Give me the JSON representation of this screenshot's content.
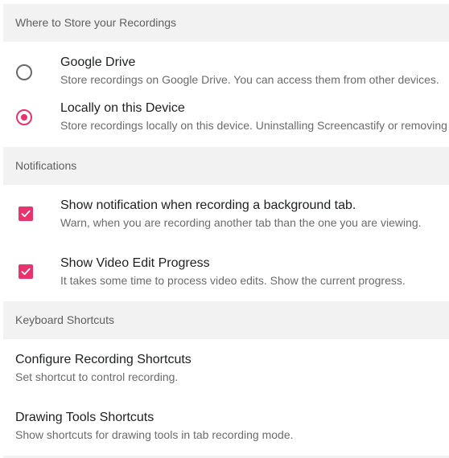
{
  "storage": {
    "header": "Where to Store your Recordings",
    "options": [
      {
        "title": "Google Drive",
        "description": "Store recordings on Google Drive. You can access them from other devices.",
        "selected": false
      },
      {
        "title": "Locally on this Device",
        "description": "Store recordings locally on this device. Uninstalling Screencastify or removing",
        "selected": true
      }
    ]
  },
  "notifications": {
    "header": "Notifications",
    "options": [
      {
        "title": "Show notification when recording a background tab.",
        "description": "Warn, when you are recording another tab than the one you are viewing.",
        "checked": true
      },
      {
        "title": "Show Video Edit Progress",
        "description": "It takes some time to process video edits. Show the current progress.",
        "checked": true
      }
    ]
  },
  "shortcuts": {
    "header": "Keyboard Shortcuts",
    "items": [
      {
        "title": "Configure Recording Shortcuts",
        "description": "Set shortcut to control recording."
      },
      {
        "title": "Drawing Tools Shortcuts",
        "description": "Show shortcuts for drawing tools in tab recording mode."
      }
    ]
  },
  "colors": {
    "accent": "#e8336e",
    "header_bg": "#f2f2f2",
    "header_text": "#5f5f5f",
    "title_text": "#202124",
    "desc_text": "#6b6b6b"
  }
}
